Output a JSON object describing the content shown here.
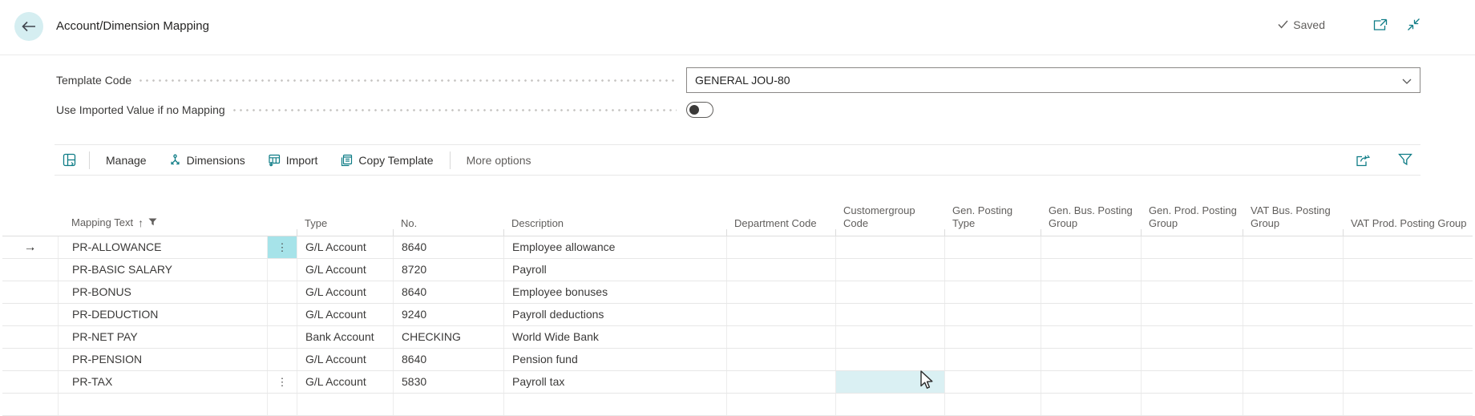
{
  "page": {
    "title": "Account/Dimension Mapping",
    "status": "Saved"
  },
  "fields": {
    "template_code": {
      "label": "Template Code",
      "value": "GENERAL JOU-80"
    },
    "use_imported_value": {
      "label": "Use Imported Value if no Mapping",
      "state": "off"
    }
  },
  "toolbar": {
    "manage": "Manage",
    "dimensions": "Dimensions",
    "import": "Import",
    "copy_template": "Copy Template",
    "more_options": "More options"
  },
  "table": {
    "columns": {
      "mapping_text": "Mapping Text",
      "type": "Type",
      "no": "No.",
      "description": "Description",
      "department_code": "Department Code",
      "customergroup_code": "Customergroup Code",
      "gen_posting_type": "Gen. Posting Type",
      "gen_bus_posting_group": "Gen. Bus. Posting Group",
      "gen_prod_posting_group": "Gen. Prod. Posting Group",
      "vat_bus_posting_group": "VAT Bus. Posting Group",
      "vat_prod_posting_group": "VAT Prod. Posting Group"
    },
    "sort": {
      "column": "Mapping Text",
      "direction": "ascending",
      "arrow": "↑"
    },
    "rows": [
      {
        "mapping_text": "PR-ALLOWANCE",
        "type": "G/L Account",
        "no": "8640",
        "description": "Employee allowance"
      },
      {
        "mapping_text": "PR-BASIC SALARY",
        "type": "G/L Account",
        "no": "8720",
        "description": "Payroll"
      },
      {
        "mapping_text": "PR-BONUS",
        "type": "G/L Account",
        "no": "8640",
        "description": "Employee bonuses"
      },
      {
        "mapping_text": "PR-DEDUCTION",
        "type": "G/L Account",
        "no": "9240",
        "description": "Payroll deductions"
      },
      {
        "mapping_text": "PR-NET PAY",
        "type": "Bank Account",
        "no": "CHECKING",
        "description": "World Wide Bank"
      },
      {
        "mapping_text": "PR-PENSION",
        "type": "G/L Account",
        "no": "8640",
        "description": "Pension fund"
      },
      {
        "mapping_text": "PR-TAX",
        "type": "G/L Account",
        "no": "5830",
        "description": "Payroll tax"
      }
    ],
    "state": {
      "active_row": "PR-ALLOWANCE",
      "active_row_indicator": "→",
      "hovered_row": "PR-TAX",
      "hovered_column": "Customergroup Code"
    },
    "glyphs": {
      "row_menu": "⋮"
    }
  },
  "colors": {
    "accent_teal": "#0e7c86",
    "selected_cell": "#a6e3e9",
    "hovered_cell": "#daf0f3",
    "back_circle": "#d5eef1"
  }
}
